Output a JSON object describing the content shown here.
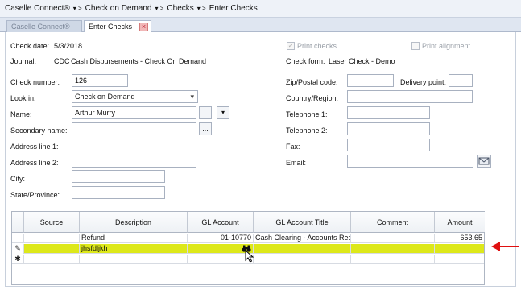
{
  "breadcrumb": {
    "items": [
      "Caselle Connect®",
      "Check on Demand",
      "Checks",
      "Enter Checks"
    ],
    "separator": "▾ >"
  },
  "tabs": [
    {
      "label": "Caselle Connect®",
      "active": false
    },
    {
      "label": "Enter Checks",
      "active": true
    }
  ],
  "form": {
    "check_date_label": "Check date:",
    "check_date": "5/3/2018",
    "journal_label": "Journal:",
    "journal_code": "CDC",
    "journal_name": "Cash Disbursements - Check On Demand",
    "print_checks_label": "Print checks",
    "print_checks_checked": true,
    "print_alignment_label": "Print alignment",
    "print_alignment_checked": false,
    "check_form_label": "Check form:",
    "check_form": "Laser Check - Demo",
    "check_number_label": "Check number:",
    "check_number": "126",
    "look_in_label": "Look in:",
    "look_in": "Check on Demand",
    "name_label": "Name:",
    "name": "Arthur Murry",
    "secondary_name_label": "Secondary name:",
    "secondary_name": "",
    "address1_label": "Address line 1:",
    "address1": "",
    "address2_label": "Address line 2:",
    "address2": "",
    "city_label": "City:",
    "city": "",
    "state_label": "State/Province:",
    "state": "",
    "zip_label": "Zip/Postal code:",
    "zip": "",
    "delivery_point_label": "Delivery point:",
    "delivery_point": "",
    "country_label": "Country/Region:",
    "country": "",
    "telephone1_label": "Telephone 1:",
    "telephone1": "",
    "telephone2_label": "Telephone 2:",
    "telephone2": "",
    "fax_label": "Fax:",
    "fax": "",
    "email_label": "Email:",
    "email": "",
    "ellipsis": "...",
    "dropdown_arrow": "▾"
  },
  "grid": {
    "columns": [
      "Source",
      "Description",
      "GL Account",
      "GL Account Title",
      "Comment",
      "Amount"
    ],
    "rows": [
      {
        "indicator": "",
        "source": "",
        "description": "Refund",
        "gl_account": "01-10770",
        "gl_title": "Cash Clearing - Accounts Rec",
        "comment": "",
        "amount": "653.65"
      },
      {
        "indicator": "✎",
        "source": "",
        "description": "jhsfdljkh",
        "gl_account": "",
        "gl_title": "",
        "comment": "",
        "amount": ""
      },
      {
        "indicator": "✱",
        "source": "",
        "description": "",
        "gl_account": "",
        "gl_title": "",
        "comment": "",
        "amount": ""
      }
    ],
    "highlight_color": "#dde81a"
  },
  "annotation": {
    "arrow_color": "#e01010"
  },
  "icons": {
    "lookup": "binoculars-icon",
    "email": "email-icon",
    "close": "close-icon"
  }
}
